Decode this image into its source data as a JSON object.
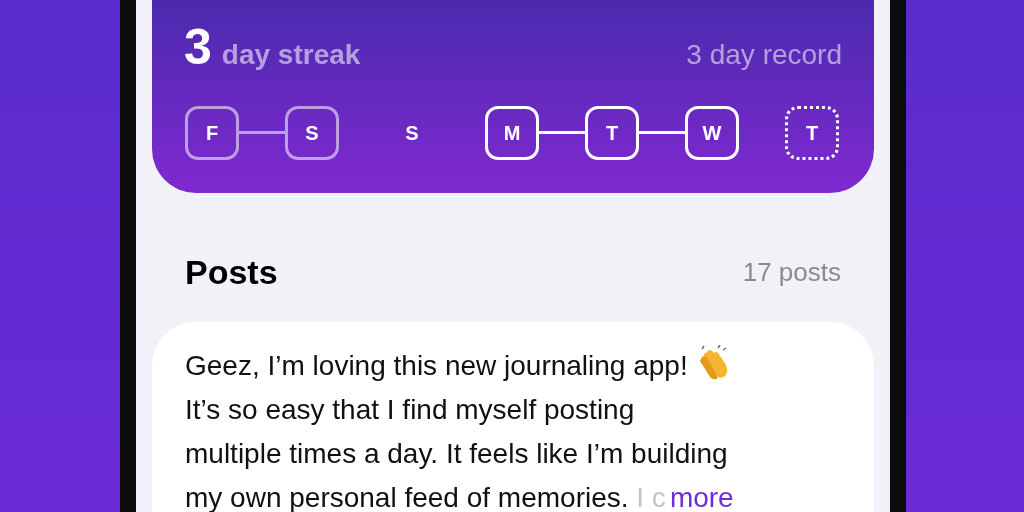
{
  "streak": {
    "count": "3",
    "label": "day streak",
    "record": "3 day record",
    "days": [
      {
        "letter": "F",
        "kind": "past",
        "linked_next": true
      },
      {
        "letter": "S",
        "kind": "past",
        "linked_next": false
      },
      {
        "letter": "S",
        "kind": "missed",
        "linked_next": false
      },
      {
        "letter": "M",
        "kind": "done",
        "linked_next": true
      },
      {
        "letter": "T",
        "kind": "done",
        "linked_next": true
      },
      {
        "letter": "W",
        "kind": "done",
        "linked_next": false
      },
      {
        "letter": "T",
        "kind": "today",
        "linked_next": false
      }
    ]
  },
  "posts": {
    "title": "Posts",
    "count": "17 posts",
    "items": [
      {
        "lines": [
          "Geez, I’m loving this new journaling app!",
          "It’s so easy that I find myself posting",
          "multiple times a day. It feels like I’m building",
          "my own personal feed of memories."
        ],
        "fading": "I c",
        "more": "more"
      }
    ]
  }
}
